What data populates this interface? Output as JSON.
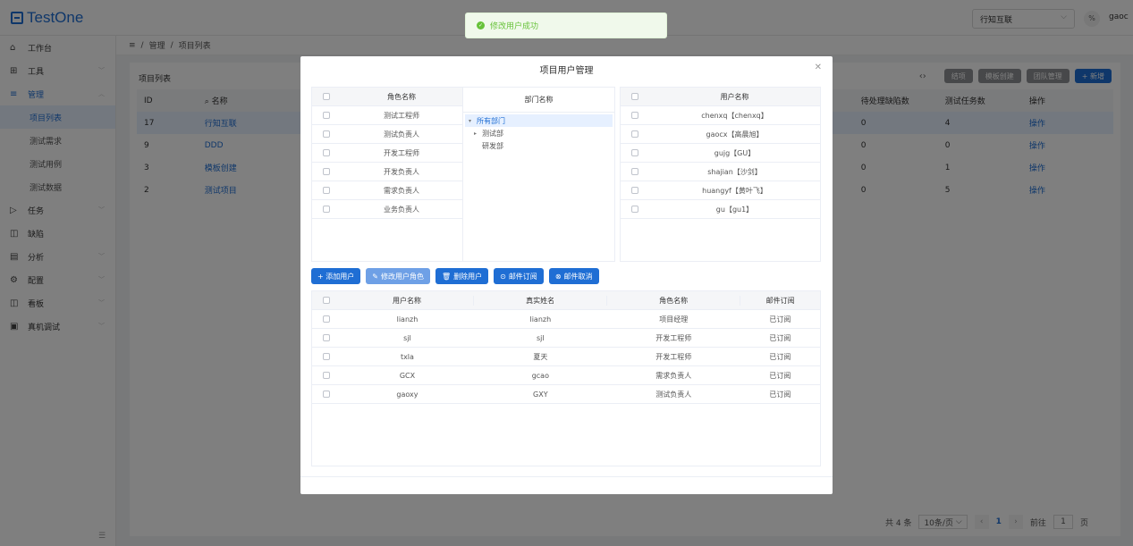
{
  "header": {
    "logo": "TestOne",
    "project_select": "行知互联",
    "user_icon": "%",
    "user_name": "gaoc"
  },
  "sidebar": {
    "items": [
      {
        "label": "工作台",
        "icon": "home-icon",
        "glyph": "⌂"
      },
      {
        "label": "工具",
        "icon": "grid-icon",
        "glyph": "⊞",
        "expandable": true
      },
      {
        "label": "管理",
        "icon": "list-icon",
        "glyph": "≡",
        "expandable": true,
        "expanded": true
      },
      {
        "label": "任务",
        "icon": "play-icon",
        "glyph": "▷",
        "expandable": true
      },
      {
        "label": "缺陷",
        "icon": "bug-icon",
        "glyph": "◫"
      },
      {
        "label": "分析",
        "icon": "calendar-icon",
        "glyph": "▤",
        "expandable": true
      },
      {
        "label": "配置",
        "icon": "gear-icon",
        "glyph": "⚙",
        "expandable": true
      },
      {
        "label": "看板",
        "icon": "board-icon",
        "glyph": "◫",
        "expandable": true
      },
      {
        "label": "真机调试",
        "icon": "device-icon",
        "glyph": "▣",
        "expandable": true
      }
    ],
    "sub_items": [
      "项目列表",
      "测试需求",
      "测试用例",
      "测试数据"
    ]
  },
  "breadcrumb": {
    "home_icon": "≡",
    "items": [
      "管理",
      "项目列表"
    ],
    "sep": "/"
  },
  "main": {
    "card_title": "项目列表",
    "buttons": {
      "finish": "结项",
      "template_create": "模板创建",
      "team_manage": "团队管理",
      "add": "+ 新增"
    },
    "columns": {
      "id": "ID",
      "name": "名称",
      "pending_defects": "待处理缺陷数",
      "test_tasks": "测试任务数",
      "action": "操作"
    },
    "rows": [
      {
        "id": "17",
        "name": "行知互联",
        "pending": "0",
        "tasks": "4",
        "action": "操作"
      },
      {
        "id": "9",
        "name": "DDD",
        "pending": "0",
        "tasks": "0",
        "action": "操作"
      },
      {
        "id": "3",
        "name": "模板创建",
        "pending": "0",
        "tasks": "1",
        "action": "操作"
      },
      {
        "id": "2",
        "name": "测试项目",
        "pending": "0",
        "tasks": "5",
        "action": "操作"
      }
    ],
    "pager": {
      "total": "共 4 条",
      "page_size": "10条/页",
      "current": "1",
      "goto_label": "前往",
      "goto_value": "1",
      "page_unit": "页"
    }
  },
  "toast": {
    "text": "修改用户成功"
  },
  "dialog": {
    "title": "项目用户管理",
    "role_table": {
      "header": "角色名称",
      "rows": [
        "测试工程师",
        "测试负责人",
        "开发工程师",
        "开发负责人",
        "需求负责人",
        "业务负责人"
      ]
    },
    "dept_panel": {
      "header": "部门名称",
      "nodes": [
        {
          "label": "所有部门",
          "level": 0,
          "caret": "▾",
          "selected": true
        },
        {
          "label": "测试部",
          "level": 1,
          "caret": "▸"
        },
        {
          "label": "研发部",
          "level": 1,
          "caret": ""
        }
      ]
    },
    "user_table": {
      "header": "用户名称",
      "rows": [
        "chenxq【chenxq】",
        "gaocx【高晨旭】",
        "gujg【GU】",
        "shajian【沙剑】",
        "huangyf【黄叶飞】",
        "gu【gu1】"
      ]
    },
    "actions": {
      "add_user": "+ 添加用户",
      "edit_role": "修改用户角色",
      "delete_user": "删除用户",
      "mail_sub": "邮件订阅",
      "mail_cancel": "邮件取消"
    },
    "member_table": {
      "columns": [
        "用户名称",
        "真实姓名",
        "角色名称",
        "邮件订阅"
      ],
      "rows": [
        [
          "lianzh",
          "lianzh",
          "项目经理",
          "已订阅"
        ],
        [
          "sjl",
          "sjl",
          "开发工程师",
          "已订阅"
        ],
        [
          "txla",
          "夏天",
          "开发工程师",
          "已订阅"
        ],
        [
          "GCX",
          "gcao",
          "需求负责人",
          "已订阅"
        ],
        [
          "gaoxy",
          "GXY",
          "测试负责人",
          "已订阅"
        ]
      ]
    }
  }
}
